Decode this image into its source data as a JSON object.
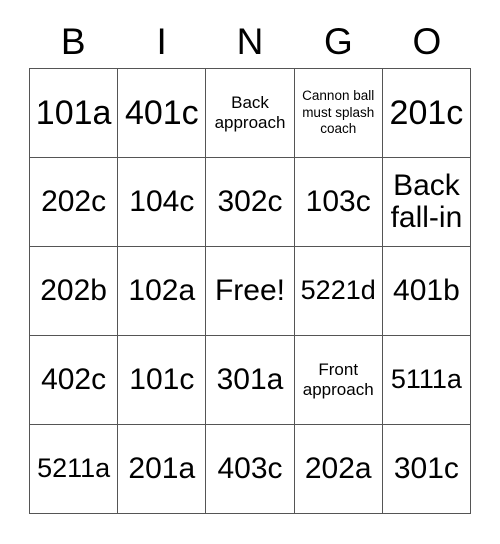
{
  "card": {
    "title": "BINGO",
    "headers": [
      "B",
      "I",
      "N",
      "G",
      "O"
    ],
    "rows": [
      [
        {
          "text": "101a",
          "size": "xl"
        },
        {
          "text": "401c",
          "size": "xl"
        },
        {
          "text": "Back approach",
          "size": "sm"
        },
        {
          "text": "Cannon ball must splash coach",
          "size": "xs"
        },
        {
          "text": "201c",
          "size": "xl"
        }
      ],
      [
        {
          "text": "202c",
          "size": "lg"
        },
        {
          "text": "104c",
          "size": "lg"
        },
        {
          "text": "302c",
          "size": "lg"
        },
        {
          "text": "103c",
          "size": "lg"
        },
        {
          "text": "Back fall-in",
          "size": "lg"
        }
      ],
      [
        {
          "text": "202b",
          "size": "lg"
        },
        {
          "text": "102a",
          "size": "lg"
        },
        {
          "text": "Free!",
          "size": "lg"
        },
        {
          "text": "5221d",
          "size": "md"
        },
        {
          "text": "401b",
          "size": "lg"
        }
      ],
      [
        {
          "text": "402c",
          "size": "lg"
        },
        {
          "text": "101c",
          "size": "lg"
        },
        {
          "text": "301a",
          "size": "lg"
        },
        {
          "text": "Front approach",
          "size": "sm"
        },
        {
          "text": "5111a",
          "size": "md"
        }
      ],
      [
        {
          "text": "5211a",
          "size": "md"
        },
        {
          "text": "201a",
          "size": "lg"
        },
        {
          "text": "403c",
          "size": "lg"
        },
        {
          "text": "202a",
          "size": "lg"
        },
        {
          "text": "301c",
          "size": "lg"
        }
      ]
    ],
    "free_space": {
      "row": 2,
      "col": 2,
      "label": "Free!"
    },
    "colors": {
      "background": "#ffffff",
      "text": "#000000",
      "border": "#555555"
    }
  }
}
